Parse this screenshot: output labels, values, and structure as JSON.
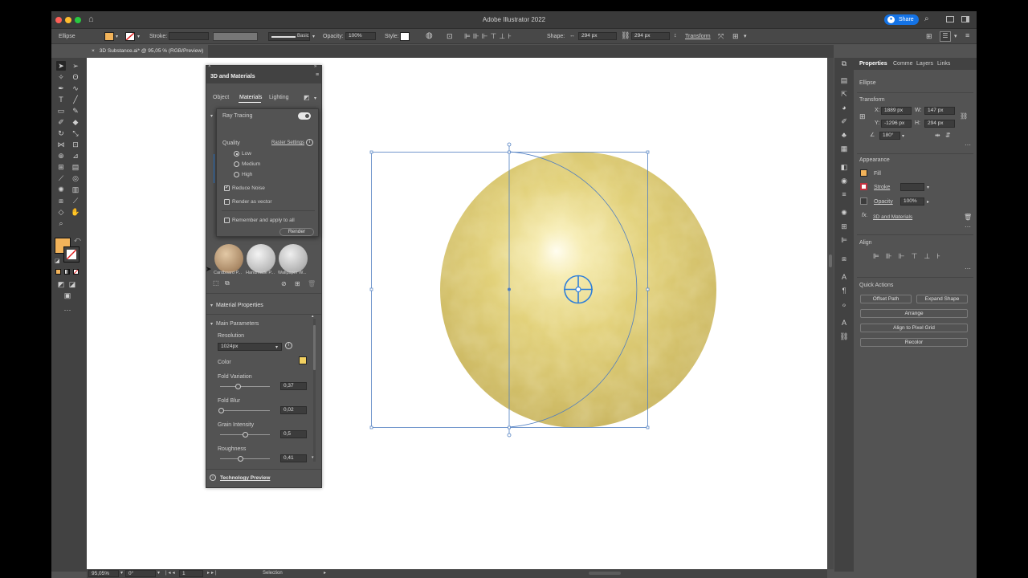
{
  "window": {
    "title": "Adobe Illustrator 2022",
    "share_label": "Share"
  },
  "control_bar": {
    "object_label": "Ellipse",
    "stroke_label": "Stroke:",
    "brush_label": "Basic",
    "opacity_label": "Opacity:",
    "opacity_value": "100%",
    "style_label": "Style:",
    "shape_label": "Shape:",
    "width_value": "294 px",
    "height_value": "294 px",
    "transform_label": "Transform",
    "fill_color": "#f2b35a"
  },
  "document_tab": {
    "label": "3D Substance.ai* @ 95,05 % (RGB/Preview)"
  },
  "status_bar": {
    "zoom": "95,05%",
    "rotation": "0°",
    "artboard": "1",
    "tool": "Selection"
  },
  "panel_3d": {
    "title": "3D and Materials",
    "tabs": [
      "Object",
      "Materials",
      "Lighting"
    ],
    "active_tab": "Materials",
    "render_settings": {
      "ray_tracing_label": "Ray Tracing",
      "quality_label": "Quality",
      "raster_settings_label": "Raster Settings",
      "quality_options": [
        "Low",
        "Medium",
        "High"
      ],
      "selected_quality": "Low",
      "reduce_noise_label": "Reduce Noise",
      "reduce_noise_checked": true,
      "render_vector_label": "Render as vector",
      "remember_label": "Remember and apply to all",
      "render_button": "Render"
    },
    "materials": [
      "Cardboard P...",
      "Handmade P...",
      "Wallpaper W..."
    ],
    "material_properties_label": "Material Properties",
    "main_parameters_label": "Main Parameters",
    "resolution_label": "Resolution",
    "resolution_value": "1024px",
    "color_label": "Color",
    "material_color": "#f2d060",
    "params": [
      {
        "label": "Fold Variation",
        "value": "0,37",
        "level": 0.37
      },
      {
        "label": "Fold Blur",
        "value": "0,02",
        "level": 0.02
      },
      {
        "label": "Grain Intensity",
        "value": "0,5",
        "level": 0.5
      },
      {
        "label": "Roughness",
        "value": "0,41",
        "level": 0.41
      }
    ],
    "tech_preview_label": "Technology Preview"
  },
  "properties": {
    "tabs": [
      "Properties",
      "Comme",
      "Layers",
      "Links"
    ],
    "object_name": "Ellipse",
    "transform_label": "Transform",
    "x_label": "X:",
    "x_value": "1889 px",
    "y_label": "Y:",
    "y_value": "-1296 px",
    "w_label": "W:",
    "w_value": "147 px",
    "h_label": "H:",
    "h_value": "294 px",
    "angle_value": "180°",
    "appearance_label": "Appearance",
    "fill_label": "Fill",
    "stroke_label": "Stroke",
    "opacity_label": "Opacity",
    "opacity_value": "100%",
    "effect_label": "3D and Materials",
    "align_label": "Align",
    "quick_actions_label": "Quick Actions",
    "offset_path": "Offset Path",
    "expand_shape": "Expand Shape",
    "arrange": "Arrange",
    "align_pixel": "Align to Pixel Grid",
    "recolor": "Recolor"
  }
}
